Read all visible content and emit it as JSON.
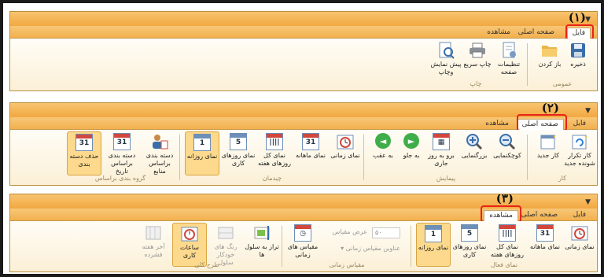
{
  "panel1": {
    "marker": "(١)",
    "tabs": [
      "فایل",
      "صفحه اصلی",
      "مشاهده"
    ],
    "buttons": [
      {
        "label": "ذخیره",
        "icon": "save-icon"
      },
      {
        "label": "باز کردن",
        "icon": "folder-open-icon"
      },
      {
        "label": "تنظیمات صفحه",
        "icon": "page-setup-icon"
      },
      {
        "label": "چاپ سریع",
        "icon": "printer-icon"
      },
      {
        "label": "پیش نمایش وچاپ",
        "icon": "print-preview-icon"
      }
    ],
    "groups": [
      "عمومی",
      "چاپ"
    ]
  },
  "panel2": {
    "marker": "(٢)",
    "tabs": [
      "فایل",
      "صفحه اصلی",
      "مشاهده"
    ],
    "buttons": [
      {
        "label": "کار تکرار شونده جدید",
        "icon": "recurring-task-icon"
      },
      {
        "label": "کار جدید",
        "icon": "new-task-icon"
      },
      {
        "label": "کوچکنمایی",
        "icon": "zoom-out-icon"
      },
      {
        "label": "بزرگنمایی",
        "icon": "zoom-in-icon"
      },
      {
        "label": "برو به روز جاری",
        "icon": "goto-today-icon"
      },
      {
        "label": "به جلو",
        "icon": "forward-icon"
      },
      {
        "label": "به عقب",
        "icon": "back-icon"
      },
      {
        "label": "نمای زمانی",
        "icon": "timeline-icon"
      },
      {
        "label": "نمای ماهانه",
        "icon": "calendar-31-icon",
        "day": "31"
      },
      {
        "label": "نمای کل روزهای هفته",
        "icon": "calendar-week-icon",
        "day": ""
      },
      {
        "label": "نمای روزهای کاری",
        "icon": "calendar-5-icon",
        "day": "5"
      },
      {
        "label": "نمای روزانه",
        "icon": "calendar-1-icon",
        "day": "1"
      },
      {
        "label": "دسته بندی براساس منابع",
        "icon": "group-by-resource-icon"
      },
      {
        "label": "دسته بندی براساس تاریخ",
        "icon": "group-by-date-icon",
        "day": "31"
      },
      {
        "label": "حذف دسته بندی",
        "icon": "ungroup-icon",
        "day": "31"
      }
    ],
    "groups": [
      "کار",
      "پیمایش",
      "چیدمان",
      "گروه بندی براساس"
    ]
  },
  "panel3": {
    "marker": "(٣)",
    "tabs": [
      "فایل",
      "صفحه اصلی",
      "مشاهده"
    ],
    "buttons": [
      {
        "label": "نمای زمانی",
        "icon": "timeline-icon"
      },
      {
        "label": "نمای ماهانه",
        "icon": "calendar-31-icon",
        "day": "31"
      },
      {
        "label": "نمای کل روزهای هفته",
        "icon": "calendar-week-icon",
        "day": ""
      },
      {
        "label": "نمای روزهای کاری",
        "icon": "calendar-5-icon",
        "day": "5"
      },
      {
        "label": "نمای روزانه",
        "icon": "calendar-1-icon",
        "day": "1"
      },
      {
        "label": "مقیاس های زمانی",
        "icon": "time-scales-icon"
      },
      {
        "label": "تراز به سلول ها",
        "icon": "snap-to-cells-icon"
      },
      {
        "label": "رنگ های خودکار سلول",
        "icon": "auto-color-icon"
      },
      {
        "label": "ساعات کاری",
        "icon": "working-hours-icon"
      },
      {
        "label": "آخر هفته فشرده",
        "icon": "compress-weekend-icon"
      }
    ],
    "scale_width_label": "عرض مقیاس",
    "scale_width_value": "۵۰",
    "scale_title_label": "عناوین مقیاس زمانی",
    "groups": [
      "نمای فعال",
      "مقیاس زمانی",
      "طرح کلی"
    ]
  }
}
